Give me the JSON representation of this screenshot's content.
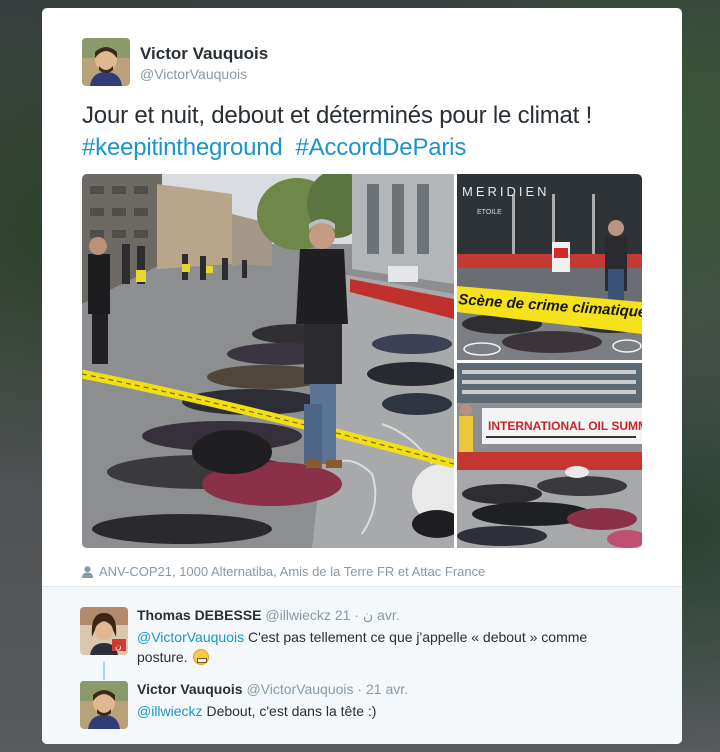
{
  "tweet": {
    "author_name": "Victor Vauquois",
    "author_handle": "@VictorVauquois",
    "text_main": "Jour et nuit, debout et déterminés pour le climat ! ",
    "hashtag_1": "#keepitintheground",
    "hashtag_2": "#AccordDeParis",
    "tagged_people": "ANV-COP21, 1000 Alternatiba, Amis de la Terre FR et Attac France"
  },
  "media": {
    "photo_top_right_banner": "Scène de crime climatique",
    "photo_bottom_right_banner": "INTERNATIONAL OIL SUMMIT",
    "photo_top_right_sign": "MERIDIEN",
    "photo_top_right_sign2": "ETOILE"
  },
  "replies": [
    {
      "name": "Thomas DEBESSE",
      "handle": "@illwieckz ن",
      "time": "21 avr.",
      "mention": "@VictorVauquois",
      "text": " C'est pas tellement ce que j'appelle « debout » comme posture. ",
      "emoji": "grimacing-face-emoji"
    },
    {
      "name": "Victor Vauquois",
      "handle": "@VictorVauquois",
      "time": "21 avr.",
      "mention": "@illwieckz",
      "text": " Debout, c'est dans la tête :)"
    }
  ],
  "separator": "·",
  "colors": {
    "link": "#1b95c9",
    "text": "#292f33",
    "muted": "#8899a6",
    "reply_bg": "#f5f8fa"
  }
}
